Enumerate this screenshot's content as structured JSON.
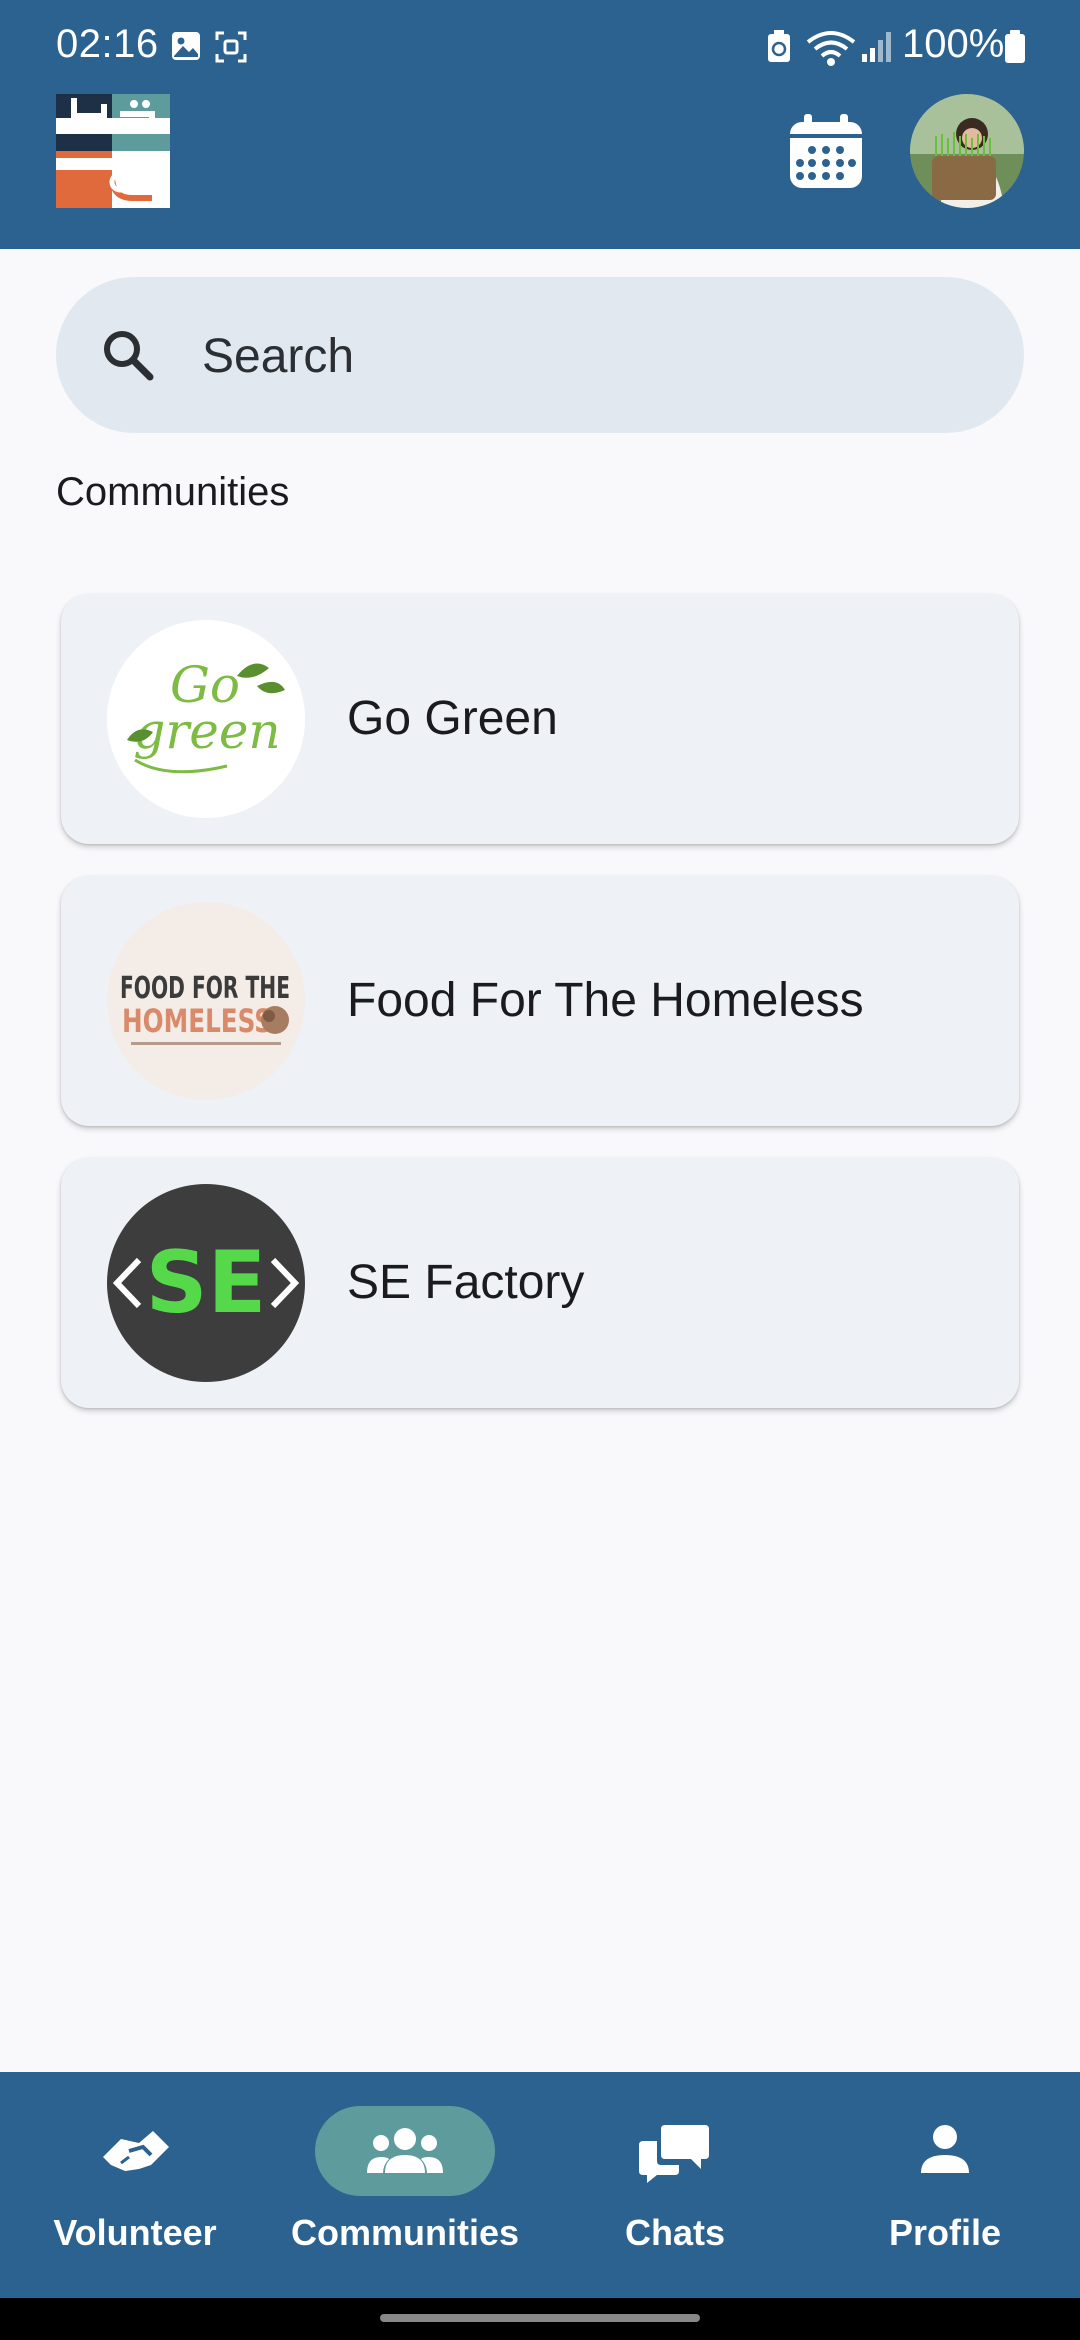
{
  "status_bar": {
    "time": "02:16",
    "battery": "100%"
  },
  "header": {
    "app_logo": "tatawwa-logo",
    "calendar_icon": "calendar-icon",
    "avatar": "user-avatar"
  },
  "search": {
    "placeholder": "Search"
  },
  "section_title": "Communities",
  "communities": [
    {
      "name": "Go Green",
      "logo_text": [
        "Go",
        "green"
      ],
      "logo_colors": {
        "text": "#7dbb44",
        "leaf": "#5a8f30"
      }
    },
    {
      "name": "Food For The Homeless",
      "logo_text": [
        "FOOD FOR THE",
        "HOMELESS"
      ],
      "logo_colors": {
        "top": "#3b3b3b",
        "bottom": "#d98a6a",
        "bg": "#f4ece6"
      }
    },
    {
      "name": "SE Factory",
      "logo_text": [
        "<SE>"
      ],
      "logo_colors": {
        "bg": "#3d3d3d",
        "text": "#55d94a"
      }
    }
  ],
  "nav": [
    {
      "label": "Volunteer",
      "icon": "handshake-icon",
      "active": false
    },
    {
      "label": "Communities",
      "icon": "groups-icon",
      "active": true
    },
    {
      "label": "Chats",
      "icon": "chat-bubbles-icon",
      "active": false
    },
    {
      "label": "Profile",
      "icon": "person-icon",
      "active": false
    }
  ],
  "colors": {
    "primary": "#2b6290",
    "active_pill": "#5e9b9d",
    "card_bg": "#eef2f6",
    "search_bg": "#e1e8ef"
  }
}
